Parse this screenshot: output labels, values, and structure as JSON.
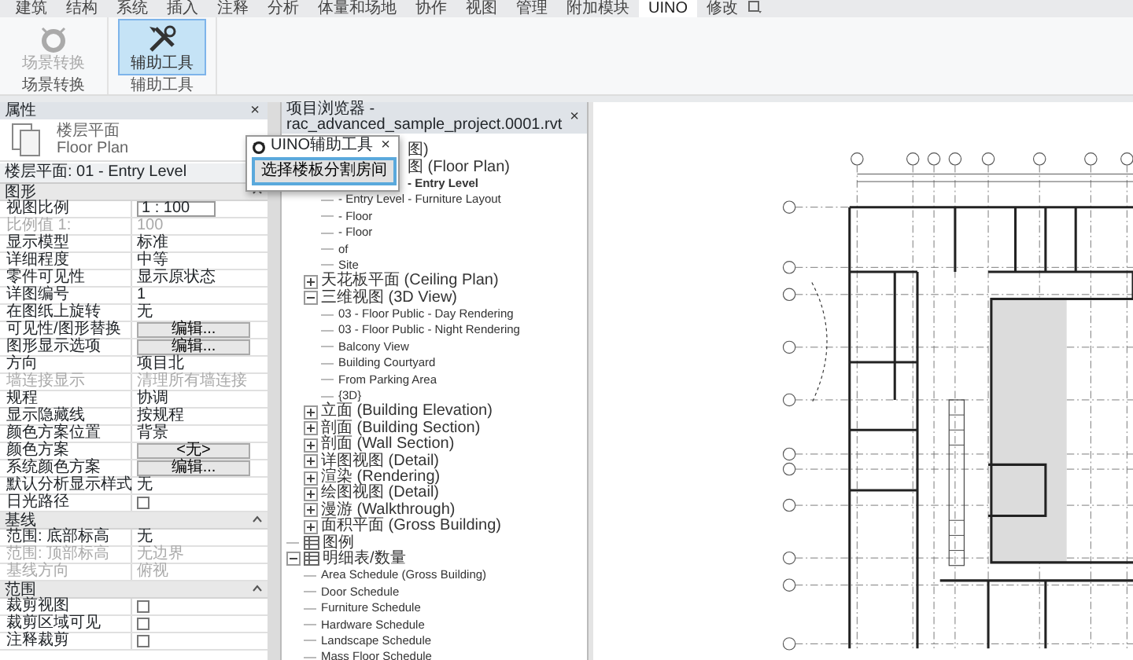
{
  "ribbon_tabs": [
    {
      "label": "建筑",
      "selected": false
    },
    {
      "label": "结构",
      "selected": false
    },
    {
      "label": "系统",
      "selected": false
    },
    {
      "label": "插入",
      "selected": false
    },
    {
      "label": "注释",
      "selected": false
    },
    {
      "label": "分析",
      "selected": false
    },
    {
      "label": "体量和场地",
      "selected": false
    },
    {
      "label": "协作",
      "selected": false
    },
    {
      "label": "视图",
      "selected": false
    },
    {
      "label": "管理",
      "selected": false
    },
    {
      "label": "附加模块",
      "selected": false
    },
    {
      "label": "UINO",
      "selected": true
    },
    {
      "label": "修改",
      "selected": false
    }
  ],
  "ribbon_groups": [
    {
      "label": "场景转换",
      "buttons": [
        {
          "label": "场景转换",
          "kind": "scene",
          "disabled": true,
          "selected": false
        }
      ]
    },
    {
      "label": "辅助工具",
      "buttons": [
        {
          "label": "辅助工具",
          "kind": "tool",
          "disabled": false,
          "selected": true
        }
      ]
    }
  ],
  "properties": {
    "title": "属性",
    "close": "×",
    "type_name": "楼层平面",
    "type_name_en": "Floor Plan",
    "instance": "楼层平面: 01 - Entry Level",
    "groups": [
      {
        "label": "图形",
        "expanded": true,
        "rows": [
          {
            "name": "视图比例",
            "kind": "field",
            "value": "1 : 100"
          },
          {
            "name": "比例值 1:",
            "kind": "disabled",
            "value": "100"
          },
          {
            "name": "显示模型",
            "kind": "text",
            "value": "标准"
          },
          {
            "name": "详细程度",
            "kind": "text",
            "value": "中等"
          },
          {
            "name": "零件可见性",
            "kind": "text",
            "value": "显示原状态"
          },
          {
            "name": "详图编号",
            "kind": "text",
            "value": "1"
          },
          {
            "name": "在图纸上旋转",
            "kind": "text",
            "value": "无"
          },
          {
            "name": "可见性/图形替换",
            "kind": "button",
            "value": "编辑..."
          },
          {
            "name": "图形显示选项",
            "kind": "button",
            "value": "编辑..."
          },
          {
            "name": "方向",
            "kind": "text",
            "value": "项目北"
          },
          {
            "name": "墙连接显示",
            "kind": "disabled",
            "value": "清理所有墙连接"
          },
          {
            "name": "规程",
            "kind": "text",
            "value": "协调"
          },
          {
            "name": "显示隐藏线",
            "kind": "text",
            "value": "按规程"
          },
          {
            "name": "颜色方案位置",
            "kind": "text",
            "value": "背景"
          },
          {
            "name": "颜色方案",
            "kind": "button",
            "value": "<无>"
          },
          {
            "name": "系统颜色方案",
            "kind": "button",
            "value": "编辑..."
          },
          {
            "name": "默认分析显示样式",
            "kind": "text",
            "value": "无"
          },
          {
            "name": "日光路径",
            "kind": "checkbox",
            "checked": false
          }
        ]
      },
      {
        "label": "基线",
        "expanded": true,
        "rows": [
          {
            "name": "范围: 底部标高",
            "kind": "text",
            "value": "无"
          },
          {
            "name": "范围: 顶部标高",
            "kind": "disabled",
            "value": "无边界"
          },
          {
            "name": "基线方向",
            "kind": "disabled",
            "value": "俯视"
          }
        ]
      },
      {
        "label": "范围",
        "expanded": true,
        "rows": [
          {
            "name": "裁剪视图",
            "kind": "checkbox",
            "checked": false
          },
          {
            "name": "裁剪区域可见",
            "kind": "checkbox",
            "checked": false
          },
          {
            "name": "注释裁剪",
            "kind": "checkbox",
            "checked": false
          }
        ]
      }
    ]
  },
  "project_browser": {
    "title": "项目浏览器 - rac_advanced_sample_project.0001.rvt",
    "close": "×",
    "tree": [
      {
        "label": "图)",
        "kind": "covered",
        "selected": false,
        "children": [
          {
            "label": "图 (Floor Plan)",
            "kind": "covered",
            "selected": false,
            "children": [
              {
                "label": "- Entry Level",
                "kind": "covered",
                "selected": true
              },
              {
                "label": "- Entry Level - Furniture Layout",
                "kind": "view",
                "selected": false
              },
              {
                "label": "- Floor",
                "kind": "view",
                "selected": false
              },
              {
                "label": "- Floor",
                "kind": "view",
                "selected": false
              },
              {
                "label": "of",
                "kind": "view",
                "selected": false
              },
              {
                "label": "Site",
                "kind": "view",
                "selected": false
              }
            ]
          },
          {
            "label": "天花板平面 (Ceiling Plan)",
            "kind": "view",
            "expanded": false,
            "selected": false
          },
          {
            "label": "三维视图 (3D View)",
            "kind": "view",
            "expanded": true,
            "selected": false,
            "children": [
              {
                "label": "03 - Floor Public - Day Rendering",
                "kind": "view",
                "selected": false
              },
              {
                "label": "03 - Floor Public - Night Rendering",
                "kind": "view",
                "selected": false
              },
              {
                "label": "Balcony View",
                "kind": "view",
                "selected": false
              },
              {
                "label": "Building Courtyard",
                "kind": "view",
                "selected": false
              },
              {
                "label": "From Parking Area",
                "kind": "view",
                "selected": false
              },
              {
                "label": "{3D}",
                "kind": "view",
                "selected": false
              }
            ]
          },
          {
            "label": "立面 (Building Elevation)",
            "kind": "view",
            "expanded": false,
            "selected": false
          },
          {
            "label": "剖面 (Building Section)",
            "kind": "view",
            "expanded": false,
            "selected": false
          },
          {
            "label": "剖面 (Wall Section)",
            "kind": "view",
            "expanded": false,
            "selected": false
          },
          {
            "label": "详图视图 (Detail)",
            "kind": "view",
            "expanded": false,
            "selected": false
          },
          {
            "label": "渲染 (Rendering)",
            "kind": "view",
            "expanded": false,
            "selected": false
          },
          {
            "label": "绘图视图 (Detail)",
            "kind": "view",
            "expanded": false,
            "selected": false
          },
          {
            "label": "漫游 (Walkthrough)",
            "kind": "view",
            "expanded": false,
            "selected": false
          },
          {
            "label": "面积平面 (Gross Building)",
            "kind": "view",
            "expanded": false,
            "selected": false
          }
        ]
      },
      {
        "label": "图例",
        "kind": "table",
        "selected": false
      },
      {
        "label": "明细表/数量",
        "kind": "table",
        "expanded": true,
        "selected": false,
        "children": [
          {
            "label": "Area Schedule (Gross Building)",
            "kind": "view",
            "selected": false
          },
          {
            "label": "Door Schedule",
            "kind": "view",
            "selected": false
          },
          {
            "label": "Furniture Schedule",
            "kind": "view",
            "selected": false
          },
          {
            "label": "Hardware Schedule",
            "kind": "view",
            "selected": false
          },
          {
            "label": "Landscape Schedule",
            "kind": "view",
            "selected": false
          },
          {
            "label": "Mass Floor Schedule",
            "kind": "view",
            "selected": false
          }
        ]
      }
    ]
  },
  "dialog": {
    "title": "UINO辅助工具",
    "close": "×",
    "button": "选择楼板分割房间"
  }
}
